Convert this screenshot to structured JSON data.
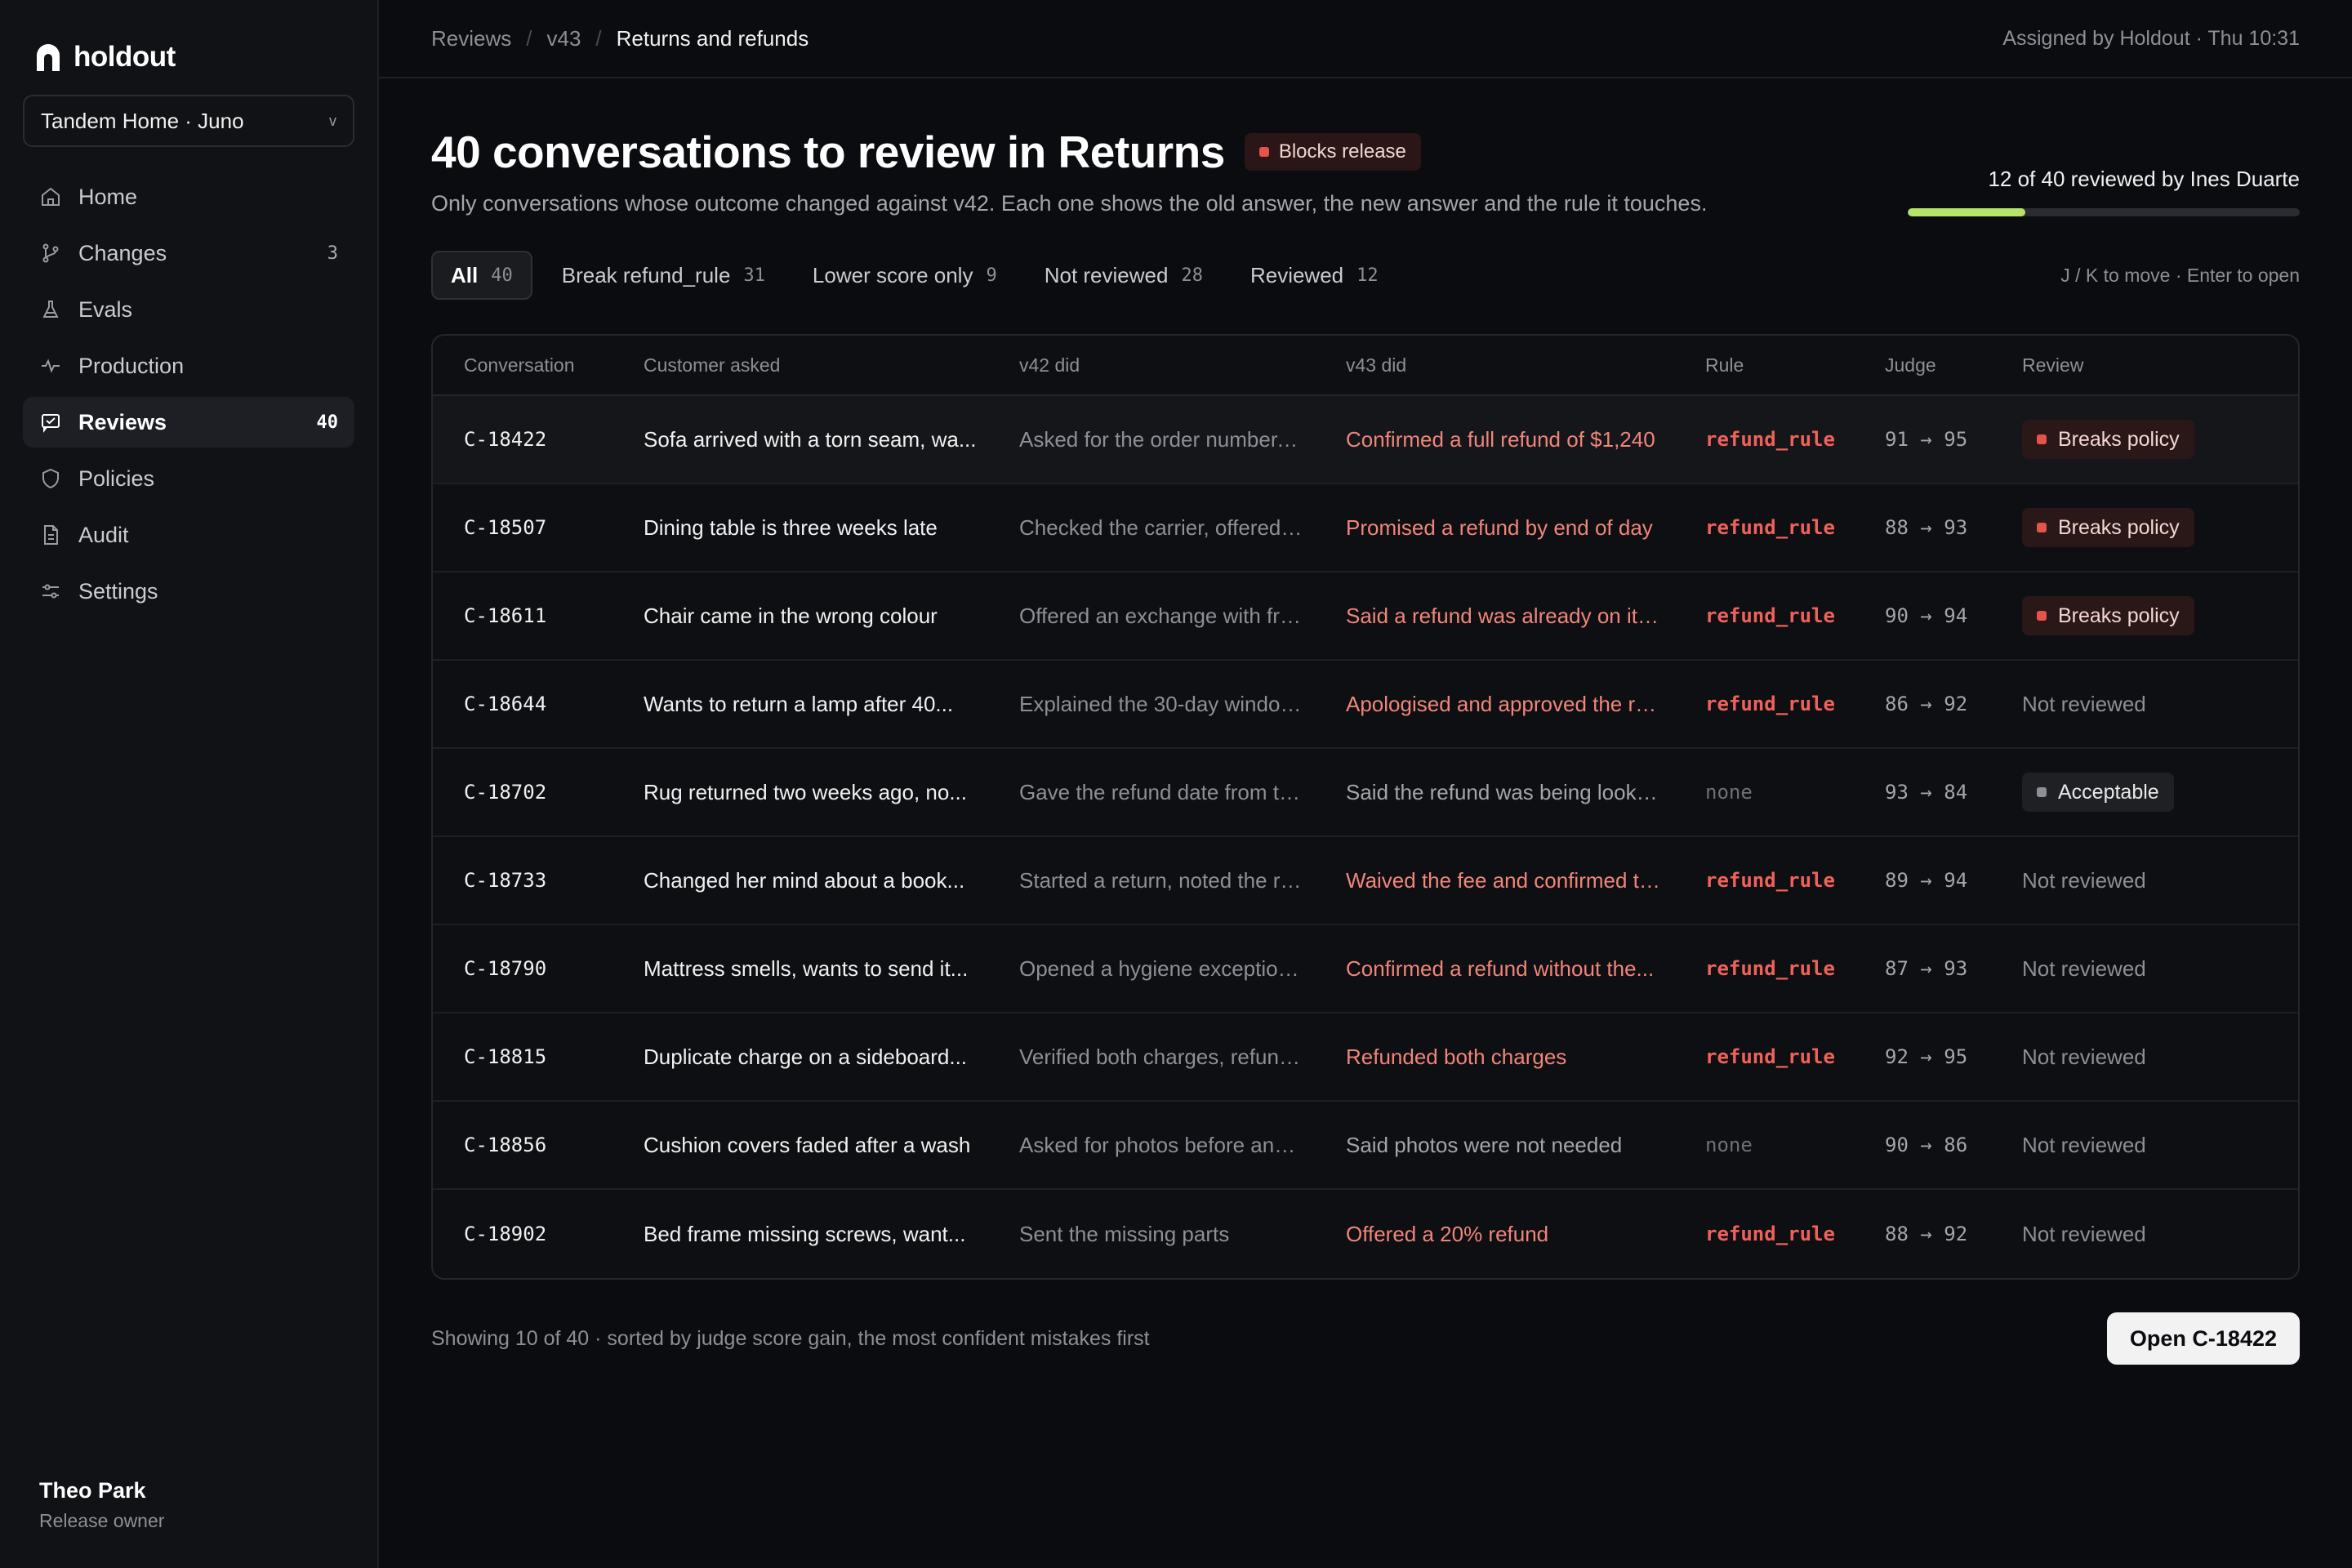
{
  "app": {
    "name": "holdout",
    "workspace": "Tandem Home · Juno"
  },
  "sidebar": {
    "items": [
      {
        "label": "Home",
        "icon": "home-icon",
        "count": ""
      },
      {
        "label": "Changes",
        "icon": "branch-icon",
        "count": "3"
      },
      {
        "label": "Evals",
        "icon": "flask-icon",
        "count": ""
      },
      {
        "label": "Production",
        "icon": "pulse-icon",
        "count": ""
      },
      {
        "label": "Reviews",
        "icon": "review-icon",
        "count": "40",
        "active": true
      },
      {
        "label": "Policies",
        "icon": "shield-icon",
        "count": ""
      },
      {
        "label": "Audit",
        "icon": "document-icon",
        "count": ""
      },
      {
        "label": "Settings",
        "icon": "sliders-icon",
        "count": ""
      }
    ],
    "user": {
      "name": "Theo Park",
      "role": "Release owner"
    }
  },
  "header": {
    "breadcrumb": [
      "Reviews",
      "v43",
      "Returns and refunds"
    ],
    "assigned": "Assigned by Holdout · Thu 10:31"
  },
  "page": {
    "title": "40 conversations to review in Returns",
    "badge": "Blocks release",
    "subtitle": "Only conversations whose outcome changed against v42. Each one shows the old answer, the new answer and the rule it touches.",
    "progress": {
      "label": "12 of 40 reviewed by Ines Duarte",
      "reviewed": 12,
      "total": 40
    }
  },
  "filters": [
    {
      "label": "All",
      "count": "40",
      "active": true
    },
    {
      "label": "Break refund_rule",
      "count": "31"
    },
    {
      "label": "Lower score only",
      "count": "9"
    },
    {
      "label": "Not reviewed",
      "count": "28"
    },
    {
      "label": "Reviewed",
      "count": "12"
    }
  ],
  "hint": "J / K to move · Enter to open",
  "table": {
    "columns": [
      "Conversation",
      "Customer asked",
      "v42 did",
      "v43 did",
      "Rule",
      "Judge",
      "Review"
    ],
    "rows": [
      {
        "id": "C-18422",
        "asked": "Sofa arrived with a torn seam, wa...",
        "old": "Asked for the order number, o...",
        "new": "Confirmed a full refund of $1,240",
        "rule": "refund_rule",
        "judge": "91 → 95",
        "review": "Breaks policy",
        "review_kind": "bad"
      },
      {
        "id": "C-18507",
        "asked": "Dining table is three weeks late",
        "old": "Checked the carrier, offered a...",
        "new": "Promised a refund by end of day",
        "rule": "refund_rule",
        "judge": "88 → 93",
        "review": "Breaks policy",
        "review_kind": "bad"
      },
      {
        "id": "C-18611",
        "asked": "Chair came in the wrong colour",
        "old": "Offered an exchange with fre...",
        "new": "Said a refund was already on its w...",
        "rule": "refund_rule",
        "judge": "90 → 94",
        "review": "Breaks policy",
        "review_kind": "bad"
      },
      {
        "id": "C-18644",
        "asked": "Wants to return a lamp after 40...",
        "old": "Explained the 30-day window...",
        "new": "Apologised and approved the ret...",
        "rule": "refund_rule",
        "judge": "86 → 92",
        "review": "Not reviewed",
        "review_kind": "none"
      },
      {
        "id": "C-18702",
        "asked": "Rug returned two weeks ago, no...",
        "old": "Gave the refund date from th...",
        "new": "Said the refund was being looked...",
        "rule": "none",
        "judge": "93 → 84",
        "review": "Acceptable",
        "review_kind": "ok"
      },
      {
        "id": "C-18733",
        "asked": "Changed her mind about a book...",
        "old": "Started a return, noted the re...",
        "new": "Waived the fee and confirmed th...",
        "rule": "refund_rule",
        "judge": "89 → 94",
        "review": "Not reviewed",
        "review_kind": "none"
      },
      {
        "id": "C-18790",
        "asked": "Mattress smells, wants to send it...",
        "old": "Opened a hygiene exception...",
        "new": "Confirmed a refund without the...",
        "rule": "refund_rule",
        "judge": "87 → 93",
        "review": "Not reviewed",
        "review_kind": "none"
      },
      {
        "id": "C-18815",
        "asked": "Duplicate charge on a sideboard...",
        "old": "Verified both charges, refund...",
        "new": "Refunded both charges",
        "rule": "refund_rule",
        "judge": "92 → 95",
        "review": "Not reviewed",
        "review_kind": "none"
      },
      {
        "id": "C-18856",
        "asked": "Cushion covers faded after a wash",
        "old": "Asked for photos before any r...",
        "new": "Said photos were not needed",
        "rule": "none",
        "judge": "90 → 86",
        "review": "Not reviewed",
        "review_kind": "none"
      },
      {
        "id": "C-18902",
        "asked": "Bed frame missing screws, want...",
        "old": "Sent the missing parts",
        "new": "Offered a 20% refund",
        "rule": "refund_rule",
        "judge": "88 → 92",
        "review": "Not reviewed",
        "review_kind": "none"
      }
    ]
  },
  "footer": {
    "note": "Showing 10 of 40 · sorted by judge score gain, the most confident mistakes first",
    "open_button": "Open C-18422"
  },
  "colors": {
    "accent_progress": "#b6e36a",
    "danger": "#e5534b",
    "rule_text": "#f0615a"
  }
}
